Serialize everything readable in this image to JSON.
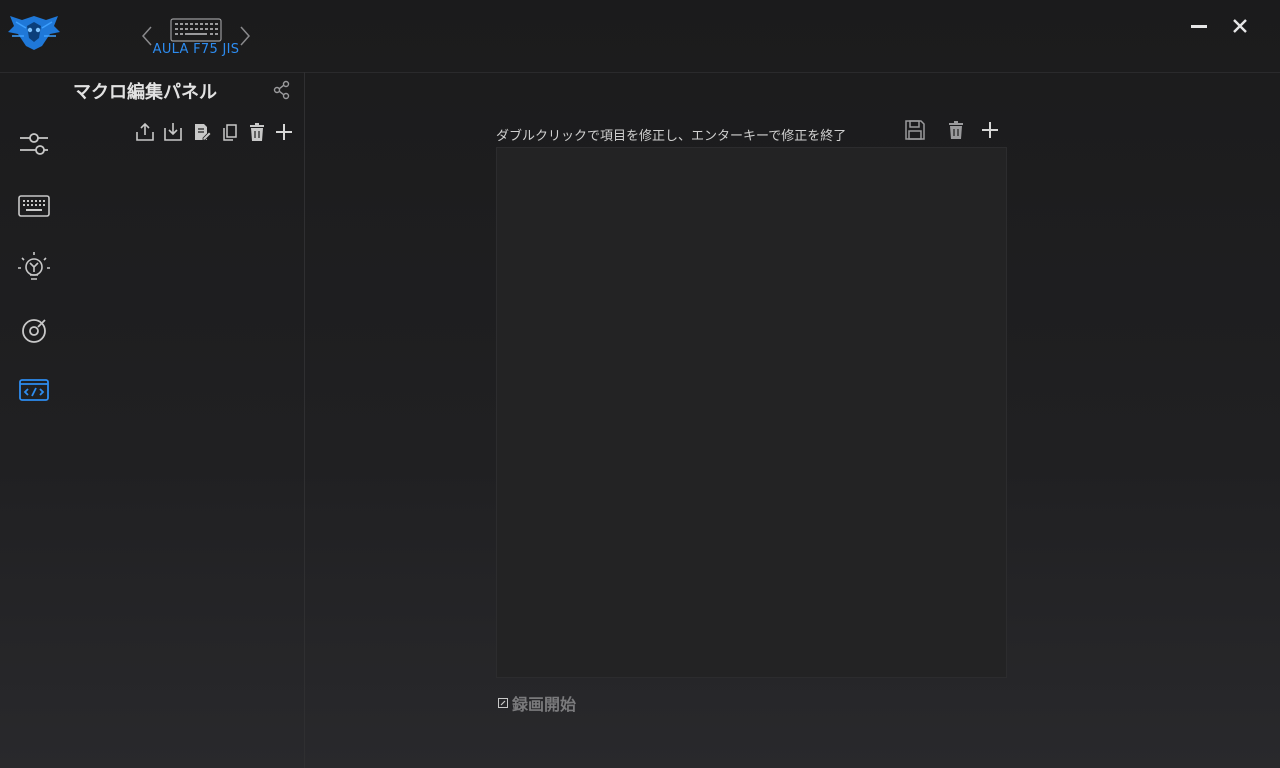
{
  "colors": {
    "accent": "#2d8cf0",
    "icon": "#c8c8c8",
    "background": "#1e1e1f"
  },
  "header": {
    "logo_icon": "spider-logo-icon",
    "device": {
      "name": "AULA F75 JIS",
      "icon": "keyboard-icon"
    },
    "window_controls": [
      "minimize-icon",
      "close-icon"
    ]
  },
  "sidebar": {
    "items": [
      {
        "icon": "sliders-icon",
        "active": false
      },
      {
        "icon": "keyboard-icon",
        "active": false
      },
      {
        "icon": "lightbulb-icon",
        "active": false
      },
      {
        "icon": "dial-icon",
        "active": false
      },
      {
        "icon": "code-icon",
        "active": true
      }
    ]
  },
  "macro_panel": {
    "title": "マクロ編集パネル",
    "tools": [
      "export-icon",
      "import-icon",
      "rename-icon",
      "copy-icon",
      "delete-icon",
      "add-icon"
    ]
  },
  "editor": {
    "hint": "ダブルクリックで項目を修正し、エンターキーで修正を終了",
    "tools": [
      "save-icon",
      "delete-icon",
      "add-icon"
    ],
    "record_label": "録画開始"
  }
}
